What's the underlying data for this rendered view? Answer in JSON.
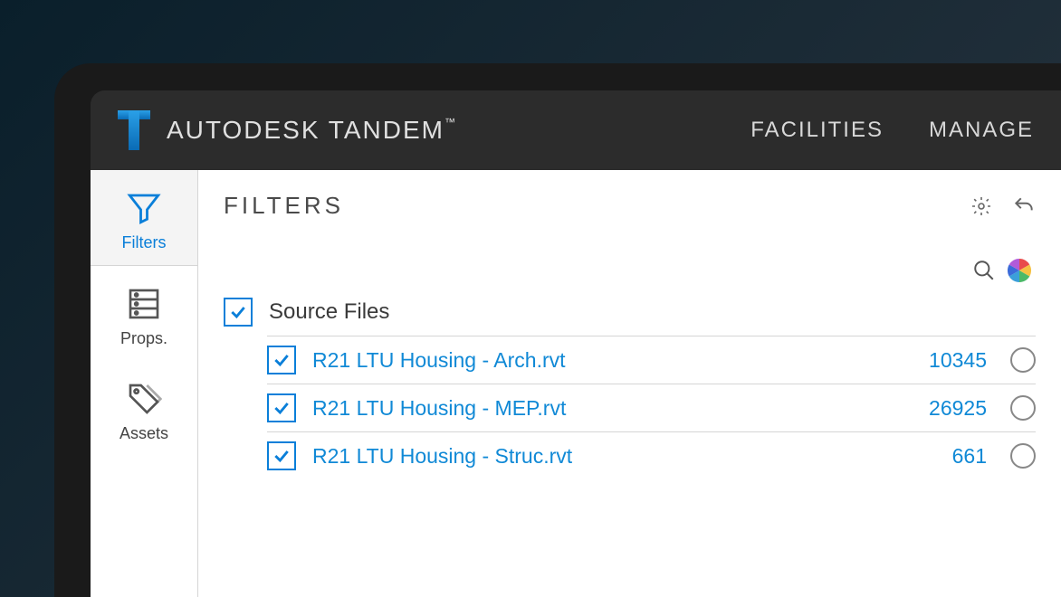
{
  "header": {
    "product": "AUTODESK TANDEM",
    "nav": [
      "FACILITIES",
      "MANAGE"
    ]
  },
  "sidebar": {
    "items": [
      {
        "label": "Filters",
        "icon": "filter",
        "active": true
      },
      {
        "label": "Props.",
        "icon": "props"
      },
      {
        "label": "Assets",
        "icon": "assets"
      }
    ]
  },
  "panel": {
    "title": "FILTERS",
    "group": {
      "label": "Source Files",
      "checked": true,
      "files": [
        {
          "name": "R21 LTU Housing - Arch.rvt",
          "count": 10345,
          "checked": true
        },
        {
          "name": "R21 LTU Housing - MEP.rvt",
          "count": 26925,
          "checked": true
        },
        {
          "name": "R21 LTU Housing - Struc.rvt",
          "count": 661,
          "checked": true
        }
      ]
    }
  }
}
